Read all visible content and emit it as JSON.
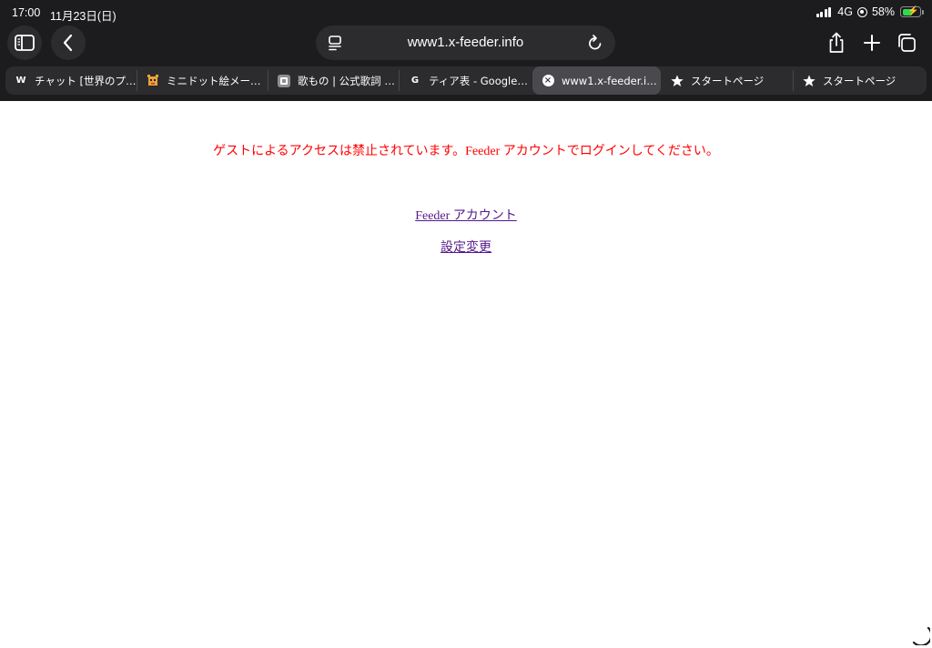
{
  "status_bar": {
    "time": "17:00",
    "date": "11月23日(日)",
    "network": "4G",
    "battery_percent": "58%",
    "battery_level": 0.58
  },
  "toolbar": {
    "url": "www1.x-feeder.info"
  },
  "tabs": [
    {
      "label": "チャット [世界のプ…",
      "favicon": "W",
      "icon": "wikipedia-favicon"
    },
    {
      "label": "ミニドット絵メーカ…",
      "favicon": "",
      "icon": "pixel-art-favicon"
    },
    {
      "label": "歌もの | 公式歌詞 &…",
      "favicon": "",
      "icon": "lyrics-favicon"
    },
    {
      "label": "ティア表 - Google…",
      "favicon": "G",
      "icon": "google-favicon"
    },
    {
      "label": "www1.x-feeder.inf…",
      "favicon": "",
      "icon": "close-tab-icon",
      "active": true
    },
    {
      "label": "スタートページ",
      "favicon": "",
      "icon": "star-icon"
    },
    {
      "label": "スタートページ",
      "favicon": "",
      "icon": "star-icon"
    }
  ],
  "page": {
    "guest_message": "ゲストによるアクセスは禁止されています。Feeder アカウントでログインしてください。",
    "account_link": "Feeder アカウント",
    "settings_link": "設定変更"
  },
  "colors": {
    "chrome_bg": "#1c1c1e",
    "message": "#ff0000",
    "link": "#551a8b"
  }
}
